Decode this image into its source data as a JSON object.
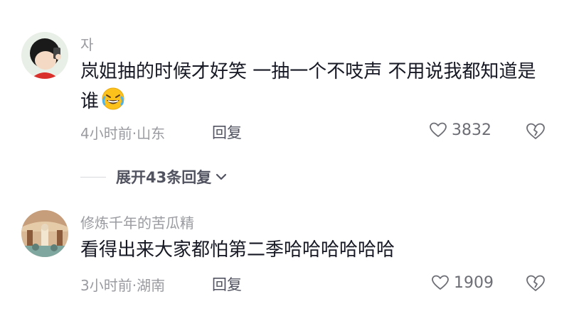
{
  "comments": [
    {
      "username": "자",
      "text": "岚姐抽的时候才好笑 一抽一个不吱声 不用说我都知道是谁",
      "emoji": "rofl-emoji",
      "time": "4小时前",
      "location": "山东",
      "meta": "4小时前·山东",
      "reply_label": "回复",
      "likes": "3832"
    },
    {
      "username": "修炼千年的苦瓜精",
      "text": "看得出来大家都怕第二季哈哈哈哈哈哈",
      "time": "3小时前",
      "location": "湖南",
      "meta": "3小时前·湖南",
      "reply_label": "回复",
      "likes": "1909"
    }
  ],
  "expand_replies": {
    "label": "展开43条回复"
  },
  "icons": {
    "like": "heart-icon",
    "dislike": "broken-heart-icon",
    "expand": "chevron-down-icon"
  },
  "colors": {
    "text": "#161823",
    "secondary": "#9a9ba0",
    "reply": "#515360"
  }
}
